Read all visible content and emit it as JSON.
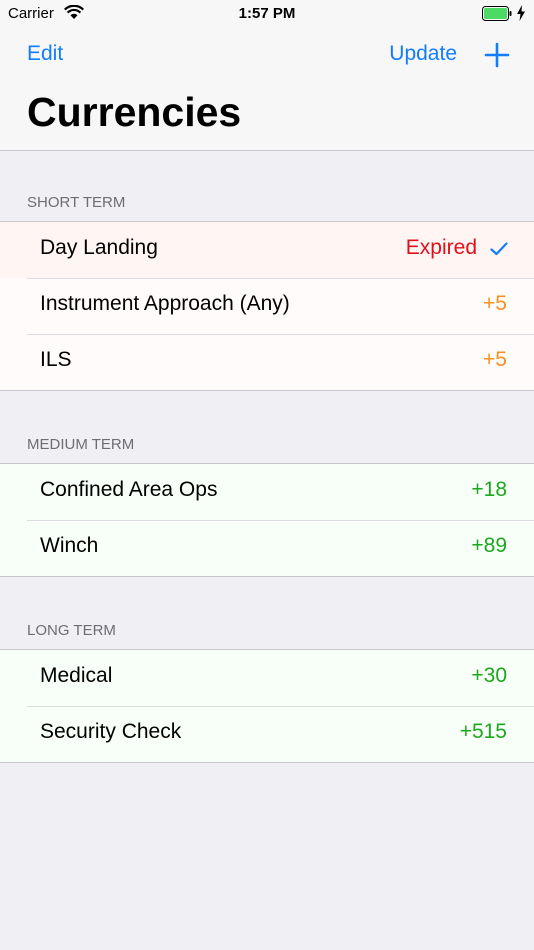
{
  "status_bar": {
    "carrier": "Carrier",
    "time": "1:57 PM"
  },
  "nav": {
    "edit_label": "Edit",
    "update_label": "Update",
    "add_icon": "plus-icon",
    "title": "Currencies"
  },
  "colors": {
    "tint": "#127dfb",
    "expired": "#e0101a",
    "warning": "#f7901e",
    "ok": "#1ca81c",
    "background": "#efeff4"
  },
  "sections": [
    {
      "header": "SHORT TERM",
      "rows": [
        {
          "label": "Day Landing",
          "value": "Expired",
          "status": "expired",
          "checked": true
        },
        {
          "label": "Instrument Approach (Any)",
          "value": "+5",
          "status": "warning"
        },
        {
          "label": "ILS",
          "value": "+5",
          "status": "warning"
        }
      ]
    },
    {
      "header": "MEDIUM TERM",
      "rows": [
        {
          "label": "Confined Area Ops",
          "value": "+18",
          "status": "ok"
        },
        {
          "label": "Winch",
          "value": "+89",
          "status": "ok"
        }
      ]
    },
    {
      "header": "LONG TERM",
      "rows": [
        {
          "label": "Medical",
          "value": "+30",
          "status": "ok"
        },
        {
          "label": "Security Check",
          "value": "+515",
          "status": "ok"
        }
      ]
    }
  ]
}
